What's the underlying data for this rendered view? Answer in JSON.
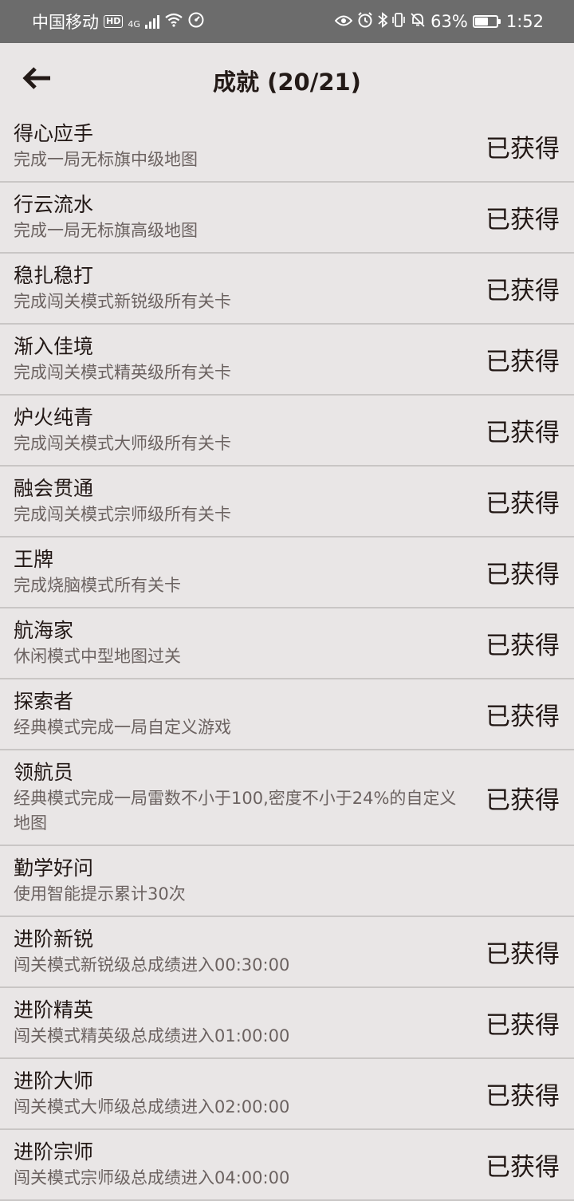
{
  "status_bar": {
    "carrier": "中国移动",
    "hd": "HD",
    "network": "4G",
    "battery": "63%",
    "battery_level": 0.63,
    "time": "1:52"
  },
  "header": {
    "title": "成就 (20/21)"
  },
  "achievements": [
    {
      "title": "得心应手",
      "desc": "完成一局无标旗中级地图",
      "status": "已获得"
    },
    {
      "title": "行云流水",
      "desc": "完成一局无标旗高级地图",
      "status": "已获得"
    },
    {
      "title": "稳扎稳打",
      "desc": "完成闯关模式新锐级所有关卡",
      "status": "已获得"
    },
    {
      "title": "渐入佳境",
      "desc": "完成闯关模式精英级所有关卡",
      "status": "已获得"
    },
    {
      "title": "炉火纯青",
      "desc": "完成闯关模式大师级所有关卡",
      "status": "已获得"
    },
    {
      "title": "融会贯通",
      "desc": "完成闯关模式宗师级所有关卡",
      "status": "已获得"
    },
    {
      "title": "王牌",
      "desc": "完成烧脑模式所有关卡",
      "status": "已获得"
    },
    {
      "title": "航海家",
      "desc": "休闲模式中型地图过关",
      "status": "已获得"
    },
    {
      "title": "探索者",
      "desc": "经典模式完成一局自定义游戏",
      "status": "已获得"
    },
    {
      "title": "领航员",
      "desc": "经典模式完成一局雷数不小于100,密度不小于24%的自定义地图",
      "status": "已获得"
    },
    {
      "title": "勤学好问",
      "desc": "使用智能提示累计30次",
      "status": ""
    },
    {
      "title": "进阶新锐",
      "desc": "闯关模式新锐级总成绩进入00:30:00",
      "status": "已获得"
    },
    {
      "title": "进阶精英",
      "desc": "闯关模式精英级总成绩进入01:00:00",
      "status": "已获得"
    },
    {
      "title": "进阶大师",
      "desc": "闯关模式大师级总成绩进入02:00:00",
      "status": "已获得"
    },
    {
      "title": "进阶宗师",
      "desc": "闯关模式宗师级总成绩进入04:00:00",
      "status": "已获得"
    }
  ]
}
